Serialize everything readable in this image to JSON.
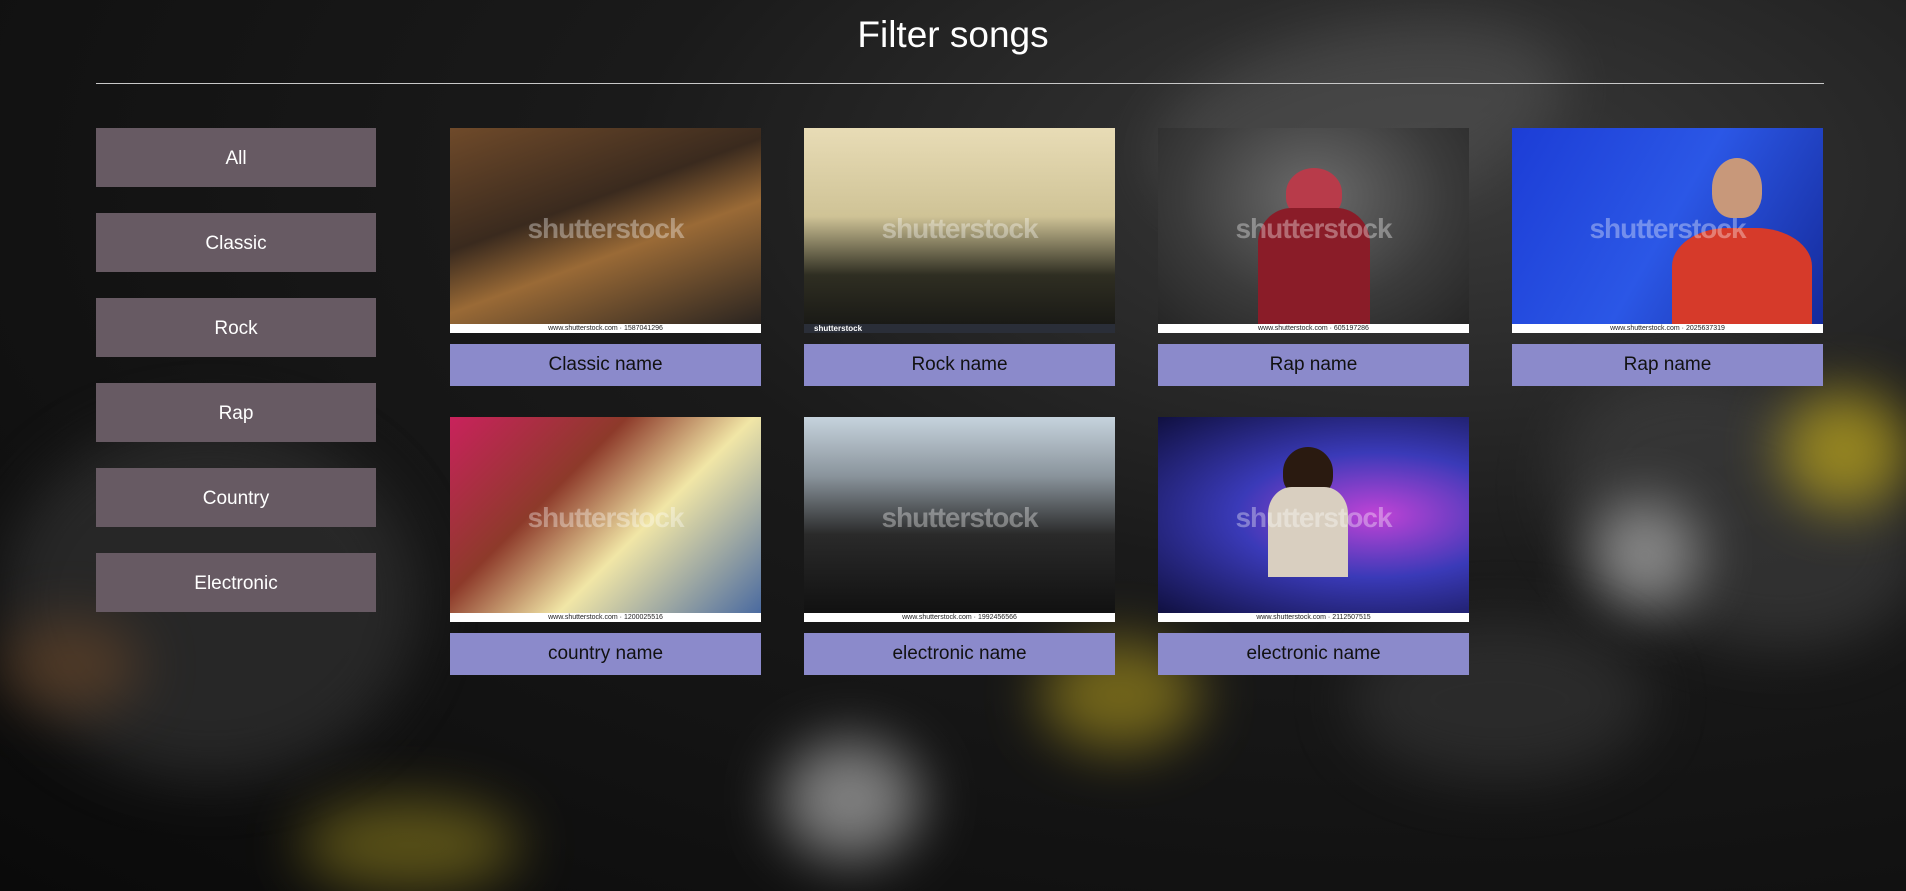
{
  "page": {
    "title": "Filter songs"
  },
  "filters": [
    {
      "label": "All"
    },
    {
      "label": "Classic"
    },
    {
      "label": "Rock"
    },
    {
      "label": "Rap"
    },
    {
      "label": "Country"
    },
    {
      "label": "Electronic"
    }
  ],
  "songs": [
    {
      "name": "Classic name",
      "watermark": "shutterstock",
      "url": "www.shutterstock.com · 1587041296"
    },
    {
      "name": "Rock name",
      "watermark": "shutterstock",
      "url": "shutterstock"
    },
    {
      "name": "Rap name",
      "watermark": "shutterstock",
      "url": "www.shutterstock.com · 605197286"
    },
    {
      "name": "Rap name",
      "watermark": "shutterstock",
      "url": "www.shutterstock.com · 2025637319"
    },
    {
      "name": "country name",
      "watermark": "shutterstock",
      "url": "www.shutterstock.com · 1200025516"
    },
    {
      "name": "electronic name",
      "watermark": "shutterstock",
      "url": "www.shutterstock.com · 1992456566"
    },
    {
      "name": "electronic name",
      "watermark": "shutterstock",
      "url": "www.shutterstock.com · 2112507515"
    }
  ],
  "colors": {
    "filter_button_bg": "#675a63",
    "caption_bg": "#8b8acb",
    "title_color": "#ffffff"
  }
}
